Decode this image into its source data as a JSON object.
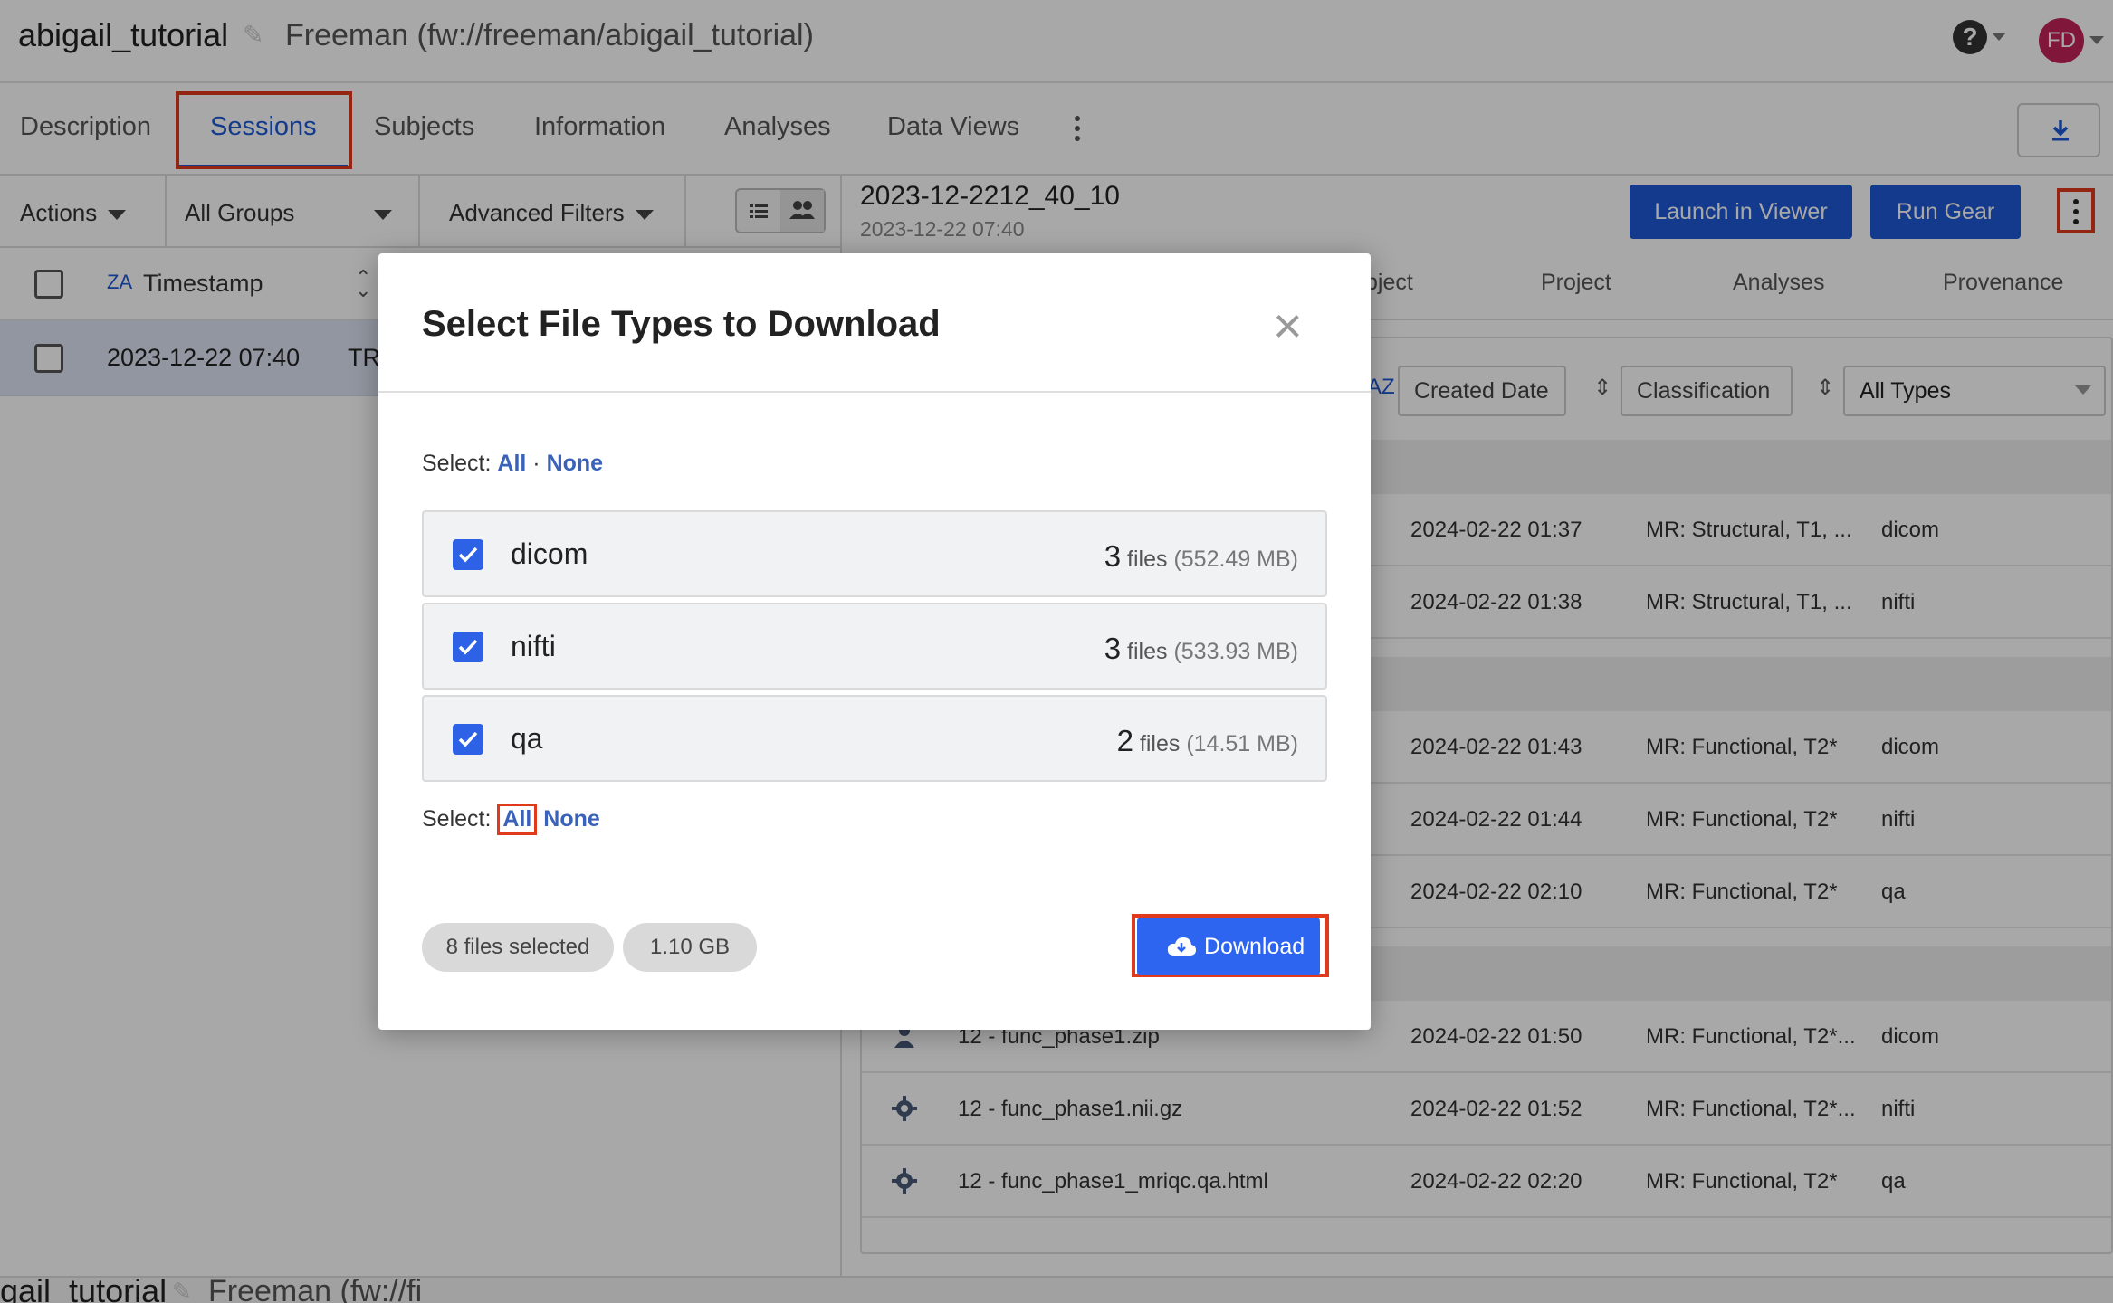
{
  "header": {
    "project_title": "abigail_tutorial",
    "project_path": "Freeman (fw://freeman/abigail_tutorial)",
    "avatar_initials": "FD"
  },
  "tabs": [
    "Description",
    "Sessions",
    "Subjects",
    "Information",
    "Analyses",
    "Data Views"
  ],
  "active_tab": "Sessions",
  "filterbar": {
    "actions": "Actions",
    "groups": "All Groups",
    "advanced_filters": "Advanced Filters"
  },
  "session_list": {
    "timestamp_header": "Timestamp",
    "sort_indicator": "ZA",
    "rows": [
      {
        "timestamp": "2023-12-22 07:40",
        "label": "TR"
      }
    ]
  },
  "session_detail": {
    "title": "2023-12-2212_40_10",
    "subtitle": "2023-12-22 07:40",
    "launch_viewer": "Launch in Viewer",
    "run_gear": "Run Gear",
    "tabs": [
      "bject",
      "Project",
      "Analyses",
      "Provenance"
    ],
    "filters": {
      "created_date": "Created Date",
      "classification": "Classification",
      "types": "All Types"
    },
    "files": [
      {
        "name": "",
        "date": "2024-02-22 01:37",
        "classification": "MR: Structural, T1, ...",
        "type": "dicom"
      },
      {
        "name": "",
        "date": "2024-02-22 01:38",
        "classification": "MR: Structural, T1, ...",
        "type": "nifti"
      },
      {
        "name": "",
        "date": "2024-02-22 01:43",
        "classification": "MR: Functional, T2*",
        "type": "dicom"
      },
      {
        "name": "",
        "date": "2024-02-22 01:44",
        "classification": "MR: Functional, T2*",
        "type": "nifti"
      },
      {
        "name": "",
        "date": "2024-02-22 02:10",
        "classification": "MR: Functional, T2*",
        "type": "qa"
      },
      {
        "name": "12 - func_phase1.zip",
        "date": "2024-02-22 01:50",
        "classification": "MR: Functional, T2*...",
        "type": "dicom"
      },
      {
        "name": "12 - func_phase1.nii.gz",
        "date": "2024-02-22 01:52",
        "classification": "MR: Functional, T2*...",
        "type": "nifti"
      },
      {
        "name": "12 - func_phase1_mriqc.qa.html",
        "date": "2024-02-22 02:20",
        "classification": "MR: Functional, T2*",
        "type": "qa"
      }
    ]
  },
  "bottom_strip": {
    "title": "igail_tutorial",
    "path": "Freeman (fw://fi"
  },
  "modal": {
    "title": "Select File Types to Download",
    "select_label": "Select:",
    "all": "All",
    "dot": "·",
    "none": "None",
    "file_types": [
      {
        "name": "dicom",
        "count": "3",
        "unit": "files",
        "size": "(552.49 MB)",
        "checked": true
      },
      {
        "name": "nifti",
        "count": "3",
        "unit": "files",
        "size": "(533.93 MB)",
        "checked": true
      },
      {
        "name": "qa",
        "count": "2",
        "unit": "files",
        "size": "(14.51 MB)",
        "checked": true
      }
    ],
    "files_selected": "8 files selected",
    "total_size": "1.10 GB",
    "download": "Download"
  },
  "colors": {
    "accent": "#1f59d6",
    "checkbox": "#2e62e6",
    "highlight": "#e0391c",
    "link": "#3a62b8"
  }
}
